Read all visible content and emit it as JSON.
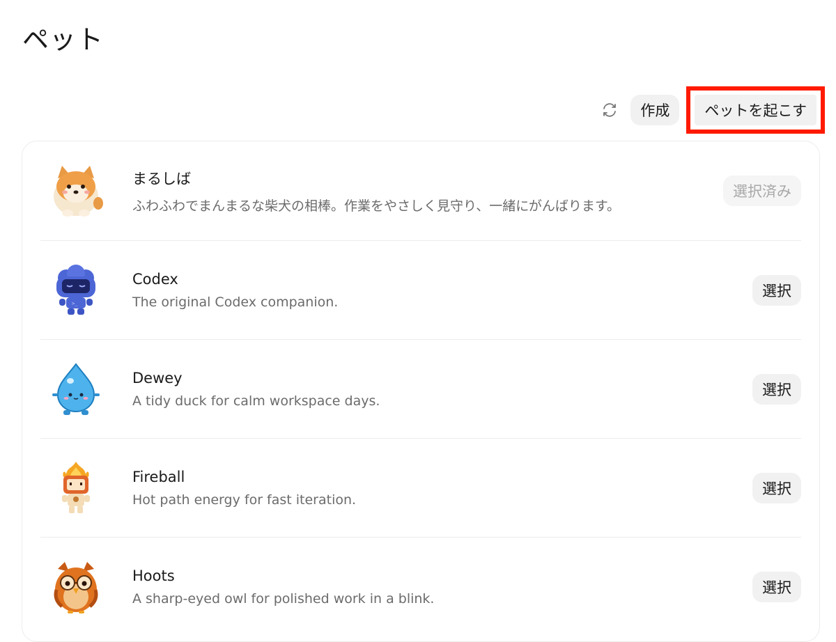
{
  "header": {
    "title": "ペット"
  },
  "toolbar": {
    "refresh_icon": "refresh-icon",
    "create_label": "作成",
    "wake_label": "ペットを起こす"
  },
  "pets": [
    {
      "name": "まるしば",
      "description": "ふわふわでまんまるな柴犬の相棒。作業をやさしく見守り、一緒にがんばります。",
      "action": "選択済み",
      "selected": true,
      "icon": "shiba-dog-icon"
    },
    {
      "name": "Codex",
      "description": "The original Codex companion.",
      "action": "選択",
      "selected": false,
      "icon": "blue-cloud-robot-icon"
    },
    {
      "name": "Dewey",
      "description": "A tidy duck for calm workspace days.",
      "action": "選択",
      "selected": false,
      "icon": "water-drop-icon"
    },
    {
      "name": "Fireball",
      "description": "Hot path energy for fast iteration.",
      "action": "選択",
      "selected": false,
      "icon": "fire-robot-icon"
    },
    {
      "name": "Hoots",
      "description": "A sharp-eyed owl for polished work in a blink.",
      "action": "選択",
      "selected": false,
      "icon": "owl-icon"
    }
  ],
  "colors": {
    "highlight": "#ff1a00",
    "button_bg": "#f1f1f1",
    "muted_text": "#6b6b6b"
  }
}
